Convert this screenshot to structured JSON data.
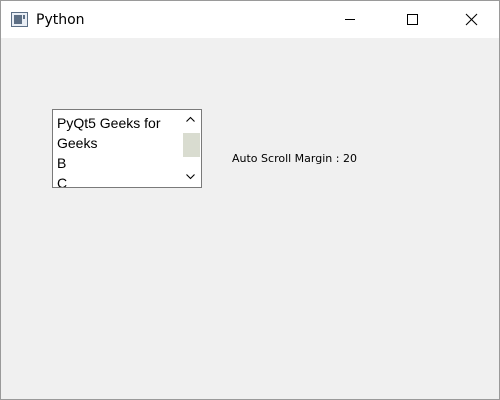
{
  "window": {
    "title": "Python",
    "icon": "python-app-icon"
  },
  "titlebar_buttons": {
    "minimize": "minimize-icon",
    "maximize": "maximize-icon",
    "close": "close-icon"
  },
  "list": {
    "items": [
      {
        "label": "PyQt5 Geeks for Geeks"
      },
      {
        "label": "B"
      },
      {
        "label": "C"
      }
    ],
    "scrollbar": {
      "up_icon": "chevron-up-icon",
      "down_icon": "chevron-down-icon"
    }
  },
  "status": {
    "auto_scroll_margin_label": "Auto Scroll Margin : 20"
  },
  "colors": {
    "window_bg": "#f0f0f0",
    "titlebar_bg": "#ffffff",
    "scroll_thumb": "#d9dcd0"
  }
}
